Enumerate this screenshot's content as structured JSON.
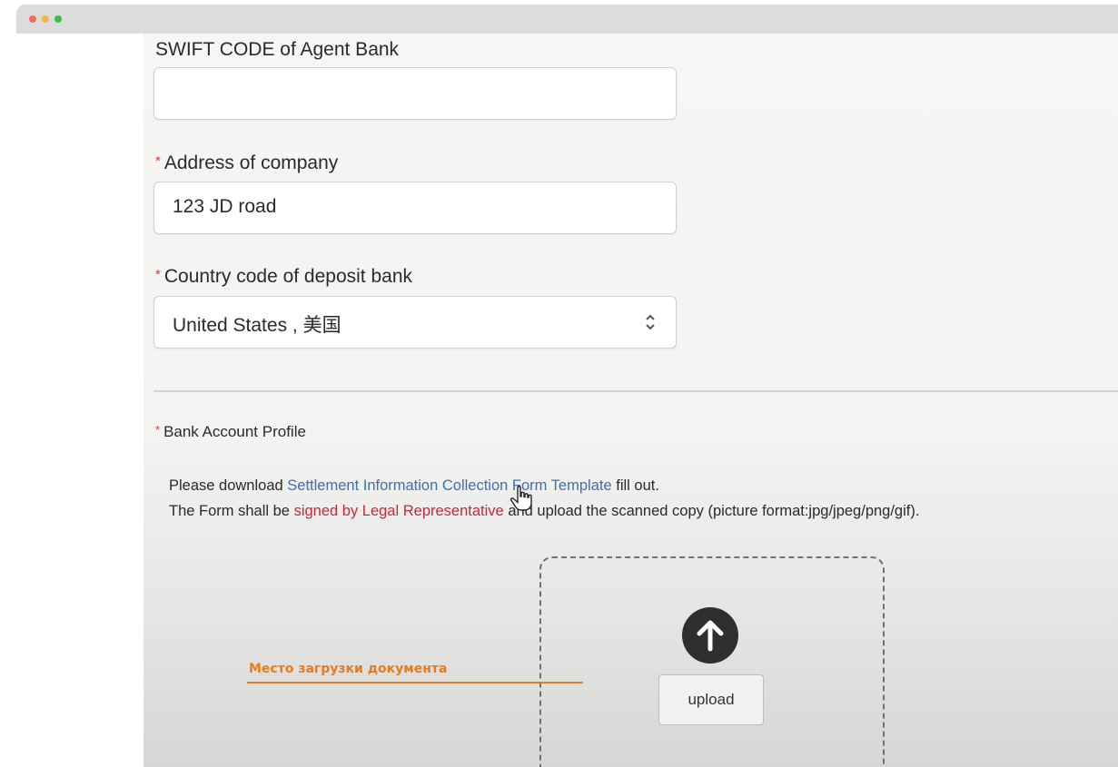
{
  "window": {
    "controls": [
      "close",
      "minimize",
      "maximize"
    ]
  },
  "form": {
    "swift_label": "SWIFT CODE of Agent Bank",
    "swift_value": "",
    "address_label": "Address of company",
    "address_value": "123 JD road",
    "country_label": "Country code of deposit bank",
    "country_value": "United States , 美国",
    "required_mark": "*"
  },
  "bank_profile": {
    "label": "Bank Account Profile",
    "line1_prefix": "Please download",
    "line1_link": "Settlement Information Collection Form Template",
    "line1_suffix": "fill out.",
    "line2_prefix": "The Form shall be",
    "line2_highlight": "signed by Legal Representative",
    "line2_suffix": "and upload the scanned copy (picture format:jpg/jpeg/png/gif).",
    "upload_button": "upload"
  },
  "annotation": {
    "text": "Место загрузки документа",
    "color": "#e77a1d"
  },
  "colors": {
    "link": "#3f6fb0",
    "highlight": "#c8283a",
    "required": "#d23b3b"
  },
  "icons": {
    "select": "chevron-up-down-icon",
    "upload": "arrow-up-circle-icon",
    "cursor": "hand-pointer-icon"
  }
}
